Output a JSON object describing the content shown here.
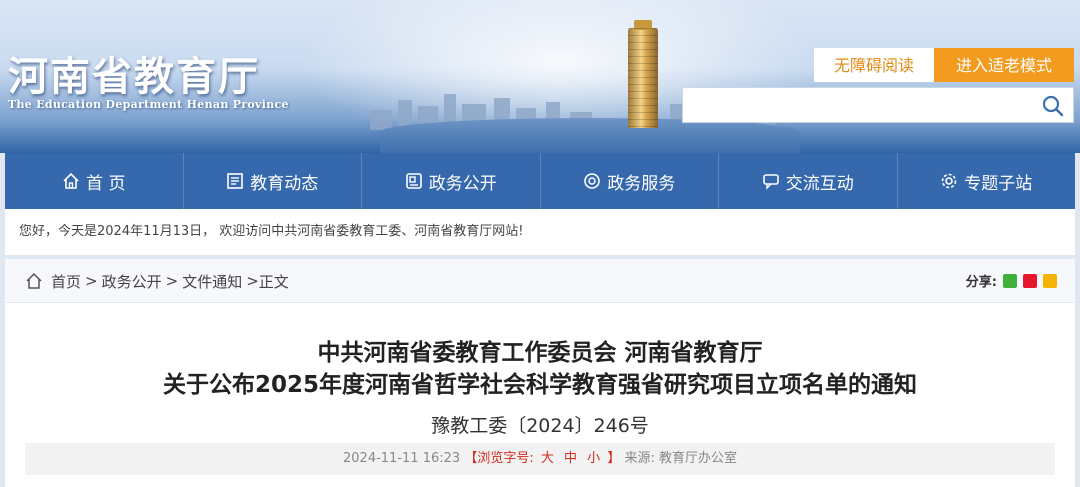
{
  "header": {
    "site_title": "河南省教育厅",
    "site_subtitle": "The Education Department Henan Province",
    "accessibility_label": "无障碍阅读",
    "elder_mode_label": "进入适老模式",
    "search": {
      "value": "",
      "placeholder": ""
    }
  },
  "nav": {
    "items": [
      {
        "label": "首 页",
        "icon": "home-icon"
      },
      {
        "label": "教育动态",
        "icon": "news-icon"
      },
      {
        "label": "政务公开",
        "icon": "book-icon"
      },
      {
        "label": "政务服务",
        "icon": "service-icon"
      },
      {
        "label": "交流互动",
        "icon": "chat-icon"
      },
      {
        "label": "专题子站",
        "icon": "gear-icon"
      }
    ]
  },
  "welcome_text": "您好，今天是2024年11月13日，  欢迎访问中共河南省委教育工委、河南省教育厅网站!",
  "breadcrumb": {
    "items": [
      "首页",
      "政务公开",
      "文件通知",
      "正文"
    ],
    "separator": ">"
  },
  "share": {
    "label": "分享:",
    "icons": [
      "wechat-icon",
      "weibo-icon",
      "qzone-icon"
    ],
    "colors": {
      "wechat": "#3fb039",
      "weibo": "#e6162d",
      "qzone": "#f4b400"
    }
  },
  "article": {
    "title_line1": "中共河南省委教育工作委员会 河南省教育厅",
    "title_line2": "关于公布2025年度河南省哲学社会科学教育强省研究项目立项名单的通知",
    "doc_number": "豫教工委〔2024〕246号",
    "date": "2024-11-11 16:23",
    "font_size_label": "【浏览字号:",
    "font_size_options": [
      "大",
      "中",
      "小"
    ],
    "font_size_close": "】",
    "source": "来源: 教育厅办公室"
  },
  "colors": {
    "nav_bg": "#3568ac",
    "accent_orange": "#f29b1f",
    "accent_red": "#d32a1f"
  }
}
